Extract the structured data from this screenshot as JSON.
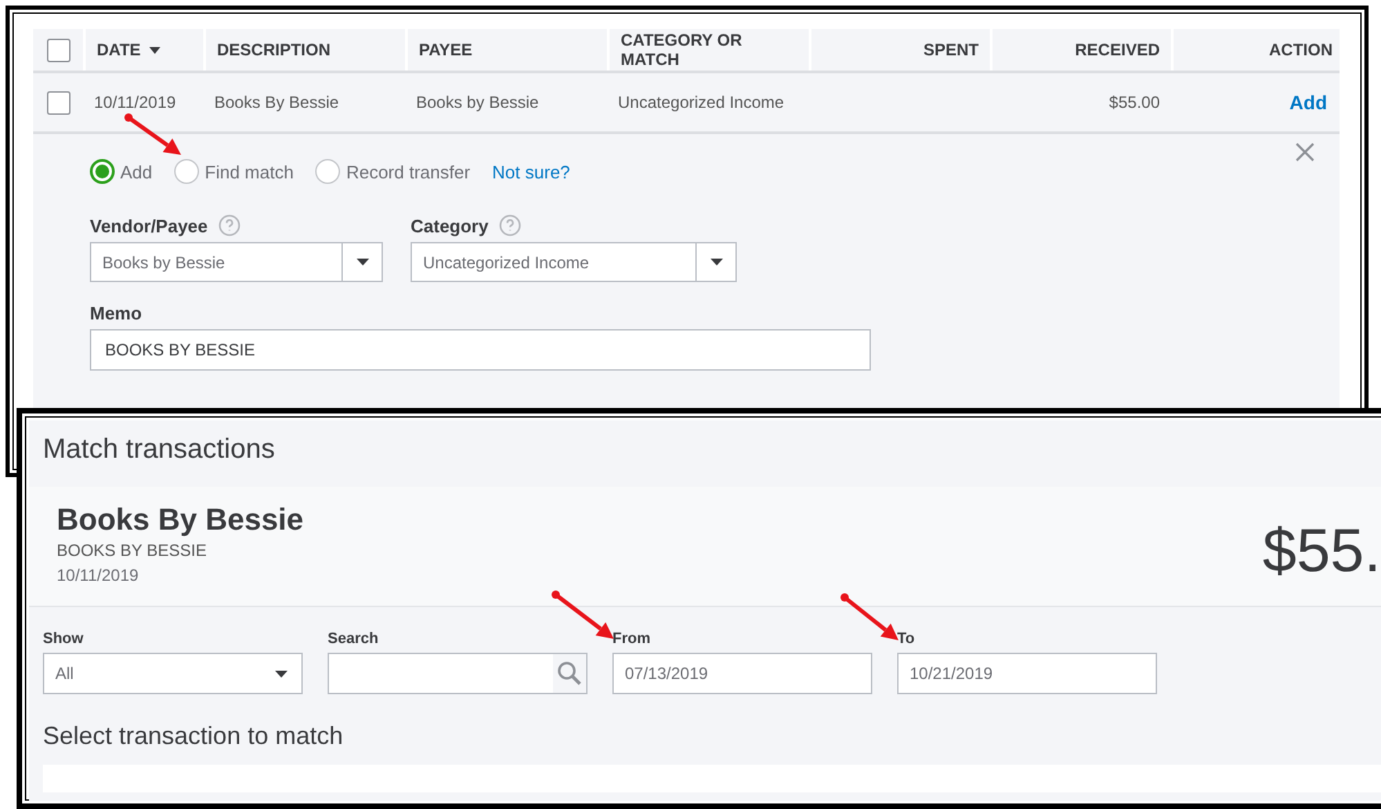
{
  "transactions": {
    "header_checked": false,
    "columns": [
      {
        "label": "DATE",
        "sorted": true
      },
      {
        "label": "DESCRIPTION",
        "sorted": false
      },
      {
        "label": "PAYEE",
        "sorted": false
      },
      {
        "label": "CATEGORY OR MATCH",
        "sorted": false
      },
      {
        "label": "SPENT",
        "sorted": false
      },
      {
        "label": "RECEIVED",
        "sorted": false
      },
      {
        "label": "ACTION",
        "sorted": false
      }
    ],
    "row": {
      "checked": false,
      "date": "10/11/2019",
      "description": "Books By Bessie",
      "payee": "Books by Bessie",
      "category": "Uncategorized Income",
      "received": "$55.00",
      "action": "Add"
    }
  },
  "detail": {
    "options": [
      {
        "label": "Add",
        "selected": true
      },
      {
        "label": "Find match",
        "selected": false
      },
      {
        "label": "Record transfer",
        "selected": false
      }
    ],
    "help_link": "Not sure?",
    "fields": [
      {
        "label": "Vendor/Payee",
        "value": "Books by Bessie"
      },
      {
        "label": "Category",
        "value": "Uncategorized Income"
      }
    ],
    "memo": {
      "label": "Memo",
      "value": "BOOKS BY BESSIE"
    }
  },
  "match_dialog": {
    "title": "Match transactions",
    "payee": "Books By Bessie",
    "bank_detail": "BOOKS BY BESSIE",
    "date": "10/11/2019",
    "amount": "$55.",
    "filters": {
      "show": {
        "label": "Show",
        "value": "All"
      },
      "search": {
        "label": "Search"
      },
      "from": {
        "label": "From",
        "value": "07/13/2019"
      },
      "to": {
        "label": "To",
        "value": "10/21/2019"
      }
    },
    "section_title": "Select transaction to match"
  }
}
